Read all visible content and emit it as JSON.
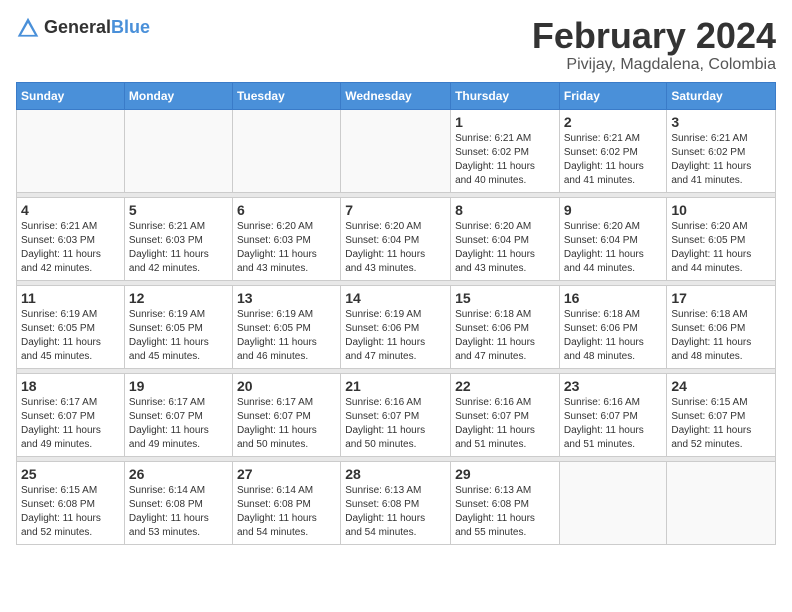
{
  "header": {
    "logo_general": "General",
    "logo_blue": "Blue",
    "month": "February 2024",
    "location": "Pivijay, Magdalena, Colombia"
  },
  "weekdays": [
    "Sunday",
    "Monday",
    "Tuesday",
    "Wednesday",
    "Thursday",
    "Friday",
    "Saturday"
  ],
  "weeks": [
    [
      {
        "day": "",
        "info": ""
      },
      {
        "day": "",
        "info": ""
      },
      {
        "day": "",
        "info": ""
      },
      {
        "day": "",
        "info": ""
      },
      {
        "day": "1",
        "info": "Sunrise: 6:21 AM\nSunset: 6:02 PM\nDaylight: 11 hours\nand 40 minutes."
      },
      {
        "day": "2",
        "info": "Sunrise: 6:21 AM\nSunset: 6:02 PM\nDaylight: 11 hours\nand 41 minutes."
      },
      {
        "day": "3",
        "info": "Sunrise: 6:21 AM\nSunset: 6:02 PM\nDaylight: 11 hours\nand 41 minutes."
      }
    ],
    [
      {
        "day": "4",
        "info": "Sunrise: 6:21 AM\nSunset: 6:03 PM\nDaylight: 11 hours\nand 42 minutes."
      },
      {
        "day": "5",
        "info": "Sunrise: 6:21 AM\nSunset: 6:03 PM\nDaylight: 11 hours\nand 42 minutes."
      },
      {
        "day": "6",
        "info": "Sunrise: 6:20 AM\nSunset: 6:03 PM\nDaylight: 11 hours\nand 43 minutes."
      },
      {
        "day": "7",
        "info": "Sunrise: 6:20 AM\nSunset: 6:04 PM\nDaylight: 11 hours\nand 43 minutes."
      },
      {
        "day": "8",
        "info": "Sunrise: 6:20 AM\nSunset: 6:04 PM\nDaylight: 11 hours\nand 43 minutes."
      },
      {
        "day": "9",
        "info": "Sunrise: 6:20 AM\nSunset: 6:04 PM\nDaylight: 11 hours\nand 44 minutes."
      },
      {
        "day": "10",
        "info": "Sunrise: 6:20 AM\nSunset: 6:05 PM\nDaylight: 11 hours\nand 44 minutes."
      }
    ],
    [
      {
        "day": "11",
        "info": "Sunrise: 6:19 AM\nSunset: 6:05 PM\nDaylight: 11 hours\nand 45 minutes."
      },
      {
        "day": "12",
        "info": "Sunrise: 6:19 AM\nSunset: 6:05 PM\nDaylight: 11 hours\nand 45 minutes."
      },
      {
        "day": "13",
        "info": "Sunrise: 6:19 AM\nSunset: 6:05 PM\nDaylight: 11 hours\nand 46 minutes."
      },
      {
        "day": "14",
        "info": "Sunrise: 6:19 AM\nSunset: 6:06 PM\nDaylight: 11 hours\nand 47 minutes."
      },
      {
        "day": "15",
        "info": "Sunrise: 6:18 AM\nSunset: 6:06 PM\nDaylight: 11 hours\nand 47 minutes."
      },
      {
        "day": "16",
        "info": "Sunrise: 6:18 AM\nSunset: 6:06 PM\nDaylight: 11 hours\nand 48 minutes."
      },
      {
        "day": "17",
        "info": "Sunrise: 6:18 AM\nSunset: 6:06 PM\nDaylight: 11 hours\nand 48 minutes."
      }
    ],
    [
      {
        "day": "18",
        "info": "Sunrise: 6:17 AM\nSunset: 6:07 PM\nDaylight: 11 hours\nand 49 minutes."
      },
      {
        "day": "19",
        "info": "Sunrise: 6:17 AM\nSunset: 6:07 PM\nDaylight: 11 hours\nand 49 minutes."
      },
      {
        "day": "20",
        "info": "Sunrise: 6:17 AM\nSunset: 6:07 PM\nDaylight: 11 hours\nand 50 minutes."
      },
      {
        "day": "21",
        "info": "Sunrise: 6:16 AM\nSunset: 6:07 PM\nDaylight: 11 hours\nand 50 minutes."
      },
      {
        "day": "22",
        "info": "Sunrise: 6:16 AM\nSunset: 6:07 PM\nDaylight: 11 hours\nand 51 minutes."
      },
      {
        "day": "23",
        "info": "Sunrise: 6:16 AM\nSunset: 6:07 PM\nDaylight: 11 hours\nand 51 minutes."
      },
      {
        "day": "24",
        "info": "Sunrise: 6:15 AM\nSunset: 6:07 PM\nDaylight: 11 hours\nand 52 minutes."
      }
    ],
    [
      {
        "day": "25",
        "info": "Sunrise: 6:15 AM\nSunset: 6:08 PM\nDaylight: 11 hours\nand 52 minutes."
      },
      {
        "day": "26",
        "info": "Sunrise: 6:14 AM\nSunset: 6:08 PM\nDaylight: 11 hours\nand 53 minutes."
      },
      {
        "day": "27",
        "info": "Sunrise: 6:14 AM\nSunset: 6:08 PM\nDaylight: 11 hours\nand 54 minutes."
      },
      {
        "day": "28",
        "info": "Sunrise: 6:13 AM\nSunset: 6:08 PM\nDaylight: 11 hours\nand 54 minutes."
      },
      {
        "day": "29",
        "info": "Sunrise: 6:13 AM\nSunset: 6:08 PM\nDaylight: 11 hours\nand 55 minutes."
      },
      {
        "day": "",
        "info": ""
      },
      {
        "day": "",
        "info": ""
      }
    ]
  ]
}
